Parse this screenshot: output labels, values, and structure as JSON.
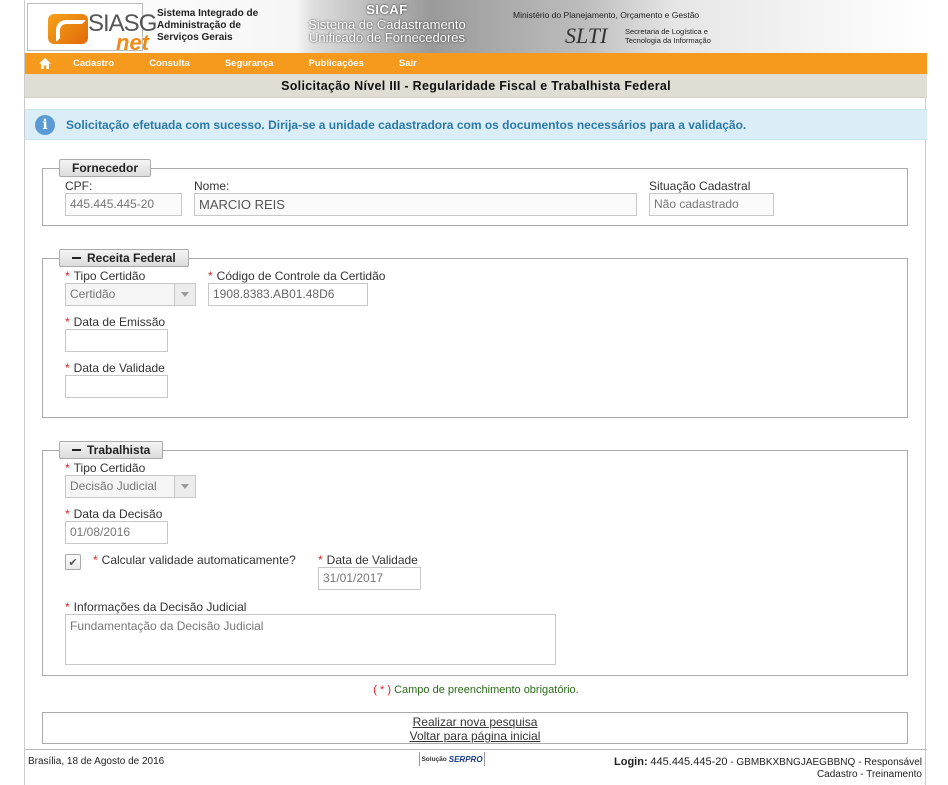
{
  "header": {
    "logo_text": "SIASG",
    "logo_sub": "net",
    "system_name": "Sistema Integrado de Administração de Serviços Gerais",
    "sicaf_title": "SICAF",
    "sicaf_subtitle": "Sistema de Cadastramento Unificado de Fornecedores",
    "ministry": "Ministério do Planejamento, Orçamento e Gestão",
    "slti": "SLTI",
    "slti_text": "Secretaria de Logística e Tecnologia da Informação"
  },
  "menu": {
    "items": [
      "Cadastro",
      "Consulta",
      "Segurança",
      "Publicações",
      "Sair"
    ]
  },
  "page_title": "Solicitação Nível III - Regularidade Fiscal e Trabalhista Federal",
  "message": "Solicitação efetuada com sucesso. Dirija-se a unidade cadastradora com os documentos necessários para a validação.",
  "fornecedor": {
    "legend": "Fornecedor",
    "cpf_label": "CPF:",
    "cpf_value": "445.445.445-20",
    "nome_label": "Nome:",
    "nome_value": "MARCIO REIS",
    "situacao_label": "Situação Cadastral",
    "situacao_value": "Não cadastrado"
  },
  "receita": {
    "legend": "Receita Federal",
    "tipo_label": "Tipo Certidão",
    "tipo_value": "Certidão",
    "codigo_label": "Código de Controle da Certidão",
    "codigo_value": "1908.8383.AB01.48D6",
    "emissao_label": "Data de Emissão",
    "emissao_value": "",
    "validade_label": "Data de Validade",
    "validade_value": ""
  },
  "trabalhista": {
    "legend": "Trabalhista",
    "tipo_label": "Tipo Certidão",
    "tipo_value": "Decisão Judicial",
    "data_decisao_label": "Data da Decisão",
    "data_decisao_value": "01/08/2016",
    "calcular_label": "Calcular validade automaticamente?",
    "calcular_checked": true,
    "validade_label": "Data de Validade",
    "validade_value": "31/01/2017",
    "info_label": "Informações da Decisão Judicial",
    "info_value": "Fundamentação da Decisão Judicial"
  },
  "required_note": "Campo de preenchimento obrigatório.",
  "required_mark": "( * )",
  "links": {
    "nova_pesquisa": "Realizar nova pesquisa",
    "voltar": "Voltar para página inicial"
  },
  "footer": {
    "date": "Brasília, 18 de Agosto de 2016",
    "solucao": "Solução",
    "serpro": "SERPRO",
    "login_label": "Login:",
    "login_cpf": "445.445.445-20",
    "login_rest": "- GBMBKXBNGJAEGBBNQ - Responsável Cadastro - Treinamento"
  },
  "colors": {
    "menu_orange": "#f69a1d",
    "info_bg": "#dbeef8",
    "info_text": "#2a79a8",
    "required_red": "#e02020"
  }
}
